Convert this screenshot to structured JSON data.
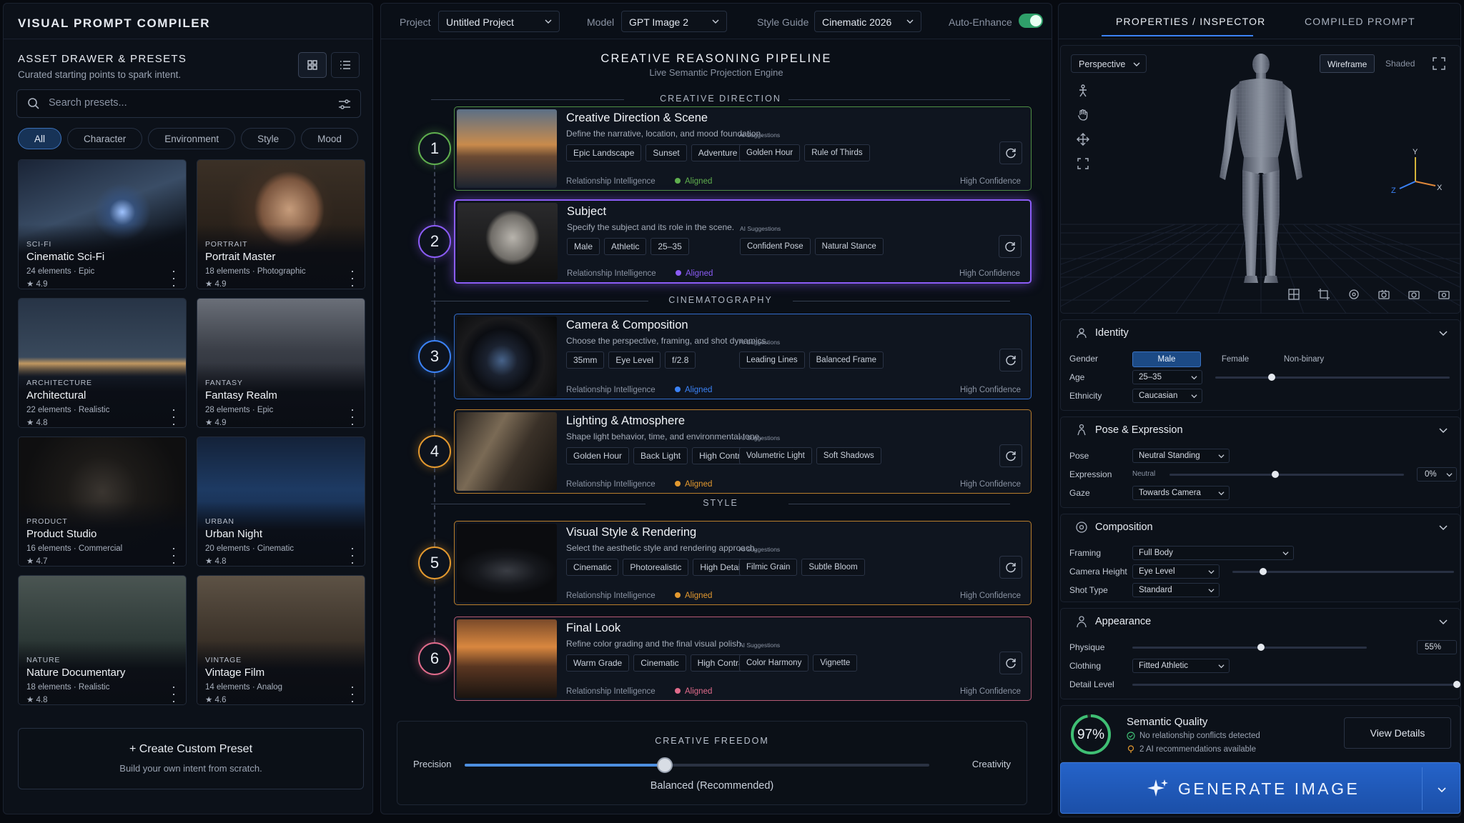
{
  "app": {
    "title": "VISUAL PROMPT COMPILER"
  },
  "drawer": {
    "title": "ASSET DRAWER & PRESETS",
    "subtitle": "Curated starting points to spark intent.",
    "search_placeholder": "Search presets...",
    "filters": [
      "All",
      "Character",
      "Environment",
      "Style",
      "Mood"
    ],
    "active_filter": "All",
    "presets": [
      {
        "category": "SCI-FI",
        "name": "Cinematic Sci-Fi",
        "meta": "24 elements · Epic",
        "rating": "★ 4.9"
      },
      {
        "category": "PORTRAIT",
        "name": "Portrait Master",
        "meta": "18 elements · Photographic",
        "rating": "★ 4.9"
      },
      {
        "category": "ARCHITECTURE",
        "name": "Architectural",
        "meta": "22 elements · Realistic",
        "rating": "★ 4.8"
      },
      {
        "category": "FANTASY",
        "name": "Fantasy Realm",
        "meta": "28 elements · Epic",
        "rating": "★ 4.9"
      },
      {
        "category": "PRODUCT",
        "name": "Product Studio",
        "meta": "16 elements · Commercial",
        "rating": "★ 4.7"
      },
      {
        "category": "URBAN",
        "name": "Urban Night",
        "meta": "20 elements · Cinematic",
        "rating": "★ 4.8"
      },
      {
        "category": "NATURE",
        "name": "Nature Documentary",
        "meta": "18 elements · Realistic",
        "rating": "★ 4.8"
      },
      {
        "category": "VINTAGE",
        "name": "Vintage Film",
        "meta": "14 elements · Analog",
        "rating": "★ 4.6"
      }
    ],
    "create": {
      "title": "+ Create Custom Preset",
      "subtitle": "Build your own intent from scratch."
    }
  },
  "topbar": {
    "project_label": "Project",
    "project_value": "Untitled Project",
    "model_label": "Model",
    "model_value": "GPT Image 2",
    "style_label": "Style Guide",
    "style_value": "Cinematic 2026",
    "auto_label": "Auto-Enhance",
    "auto_on": true
  },
  "pipeline": {
    "title": "CREATIVE REASONING PIPELINE",
    "subtitle": "Live Semantic Projection Engine",
    "sections": [
      "CREATIVE DIRECTION",
      "CINEMATOGRAPHY",
      "STYLE"
    ],
    "ai_label": "AI Suggestions",
    "rel_label": "Relationship Intelligence",
    "aligned_label": "Aligned",
    "confidence_label": "High Confidence",
    "steps": [
      {
        "num": "1",
        "title": "Creative Direction & Scene",
        "desc": "Define the narrative, location, and mood foundation.",
        "tags": [
          "Epic Landscape",
          "Sunset",
          "Adventure"
        ],
        "ai": [
          "Golden Hour",
          "Rule of Thirds"
        ],
        "color": "#5fae4e"
      },
      {
        "num": "2",
        "title": "Subject",
        "desc": "Specify the subject and its role in the scene.",
        "tags": [
          "Male",
          "Athletic",
          "25–35"
        ],
        "ai": [
          "Confident Pose",
          "Natural Stance"
        ],
        "color": "#8b5cf6"
      },
      {
        "num": "3",
        "title": "Camera & Composition",
        "desc": "Choose the perspective, framing, and shot dynamics.",
        "tags": [
          "35mm",
          "Eye Level",
          "f/2.8"
        ],
        "ai": [
          "Leading Lines",
          "Balanced Frame"
        ],
        "color": "#3b82f6"
      },
      {
        "num": "4",
        "title": "Lighting & Atmosphere",
        "desc": "Shape light behavior, time, and environmental tone.",
        "tags": [
          "Golden Hour",
          "Back Light",
          "High Contrast"
        ],
        "ai": [
          "Volumetric Light",
          "Soft Shadows"
        ],
        "color": "#e3992f"
      },
      {
        "num": "5",
        "title": "Visual Style & Rendering",
        "desc": "Select the aesthetic style and rendering approach.",
        "tags": [
          "Cinematic",
          "Photorealistic",
          "High Detail"
        ],
        "ai": [
          "Filmic Grain",
          "Subtle Bloom"
        ],
        "color": "#e3992f"
      },
      {
        "num": "6",
        "title": "Final Look",
        "desc": "Refine color grading and the final visual polish.",
        "tags": [
          "Warm Grade",
          "Cinematic",
          "High Contrast"
        ],
        "ai": [
          "Color Harmony",
          "Vignette"
        ],
        "color": "#e06b8b"
      }
    ]
  },
  "freedom": {
    "title": "CREATIVE FREEDOM",
    "left": "Precision",
    "right": "Creativity",
    "value": 0.43,
    "label": "Balanced (Recommended)"
  },
  "inspector": {
    "tabs": [
      "PROPERTIES / INSPECTOR",
      "COMPILED PROMPT"
    ],
    "active_tab": 0,
    "view_mode": "Perspective",
    "render_modes": [
      "Wireframe",
      "Shaded"
    ],
    "active_render": "Wireframe",
    "axes": {
      "x": "X",
      "y": "Y",
      "z": "Z"
    },
    "identity": {
      "title": "Identity",
      "gender_label": "Gender",
      "genders": [
        "Male",
        "Female",
        "Non-binary"
      ],
      "gender_selected": "Male",
      "age_label": "Age",
      "age_value": "25–35",
      "age_slider": 0.24,
      "ethnicity_label": "Ethnicity",
      "ethnicity_value": "Caucasian"
    },
    "pose": {
      "title": "Pose & Expression",
      "pose_label": "Pose",
      "pose_value": "Neutral Standing",
      "expr_label": "Expression",
      "expr_hint": "Neutral",
      "expr_slider": 0.45,
      "expr_pct": "0%",
      "gaze_label": "Gaze",
      "gaze_value": "Towards Camera"
    },
    "composition": {
      "title": "Composition",
      "framing_label": "Framing",
      "framing_value": "Full Body",
      "height_label": "Camera Height",
      "height_value": "Eye Level",
      "height_slider": 0.14,
      "shot_label": "Shot Type",
      "shot_value": "Standard"
    },
    "appearance": {
      "title": "Appearance",
      "physique_label": "Physique",
      "physique_slider": 0.55,
      "physique_pct": "55%",
      "clothing_label": "Clothing",
      "clothing_value": "Fitted Athletic",
      "detail_label": "Detail Level",
      "detail_slider": 1.0
    },
    "quality": {
      "score": "97%",
      "score_value": 0.97,
      "title": "Semantic Quality",
      "line1": "No relationship conflicts detected",
      "line2": "2 AI recommendations available",
      "button": "View Details"
    },
    "generate": "GENERATE IMAGE"
  },
  "colors": {
    "accent": "#2563c9",
    "green": "#3fbf74",
    "purple": "#8b5cf6",
    "blue": "#3b82f6",
    "amber": "#e3992f",
    "pink": "#e06b8b"
  }
}
